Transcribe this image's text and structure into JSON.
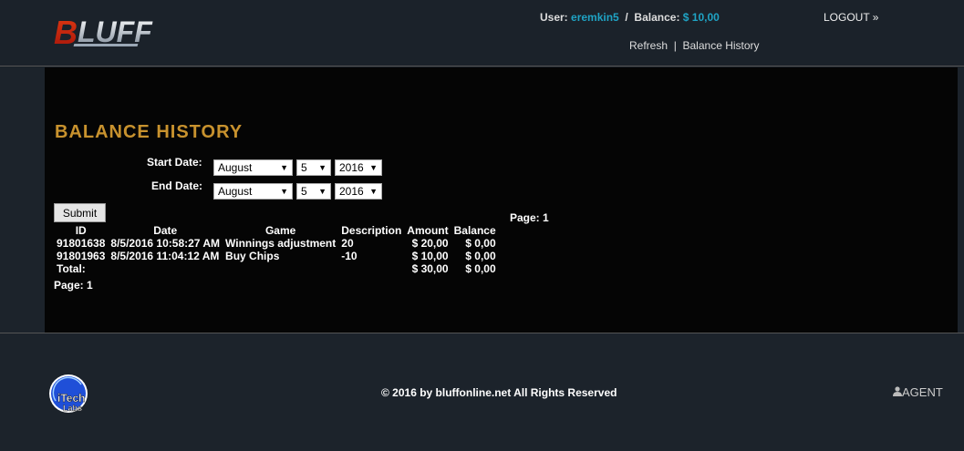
{
  "header": {
    "logo_text": "BLUFF",
    "user_label": "User:",
    "username": "eremkin5",
    "separator": "/",
    "balance_label": "Balance:",
    "balance": "$ 10,00",
    "logout": "LOGOUT »",
    "refresh": "Refresh",
    "link_sep": "|",
    "balance_history": "Balance History"
  },
  "page": {
    "title": "BALANCE HISTORY",
    "start_label": "Start Date:",
    "end_label": "End Date:",
    "start": {
      "month": "August",
      "day": "5",
      "year": "2016"
    },
    "end": {
      "month": "August",
      "day": "5",
      "year": "2016"
    },
    "submit": "Submit",
    "page_top": "Page:  1",
    "page_bottom": "Page:  1"
  },
  "table": {
    "columns": [
      "ID",
      "Date",
      "Game",
      "Description",
      "Amount",
      "Balance"
    ],
    "rows": [
      [
        "91801638",
        "8/5/2016 10:58:27 AM",
        "Winnings adjustment",
        "20",
        "$ 20,00",
        "$ 0,00"
      ],
      [
        "91801963",
        "8/5/2016 11:04:12 AM",
        "Buy Chips",
        "-10",
        "$ 10,00",
        "$ 0,00"
      ]
    ],
    "total_label": "Total:",
    "total_amount": "$ 30,00",
    "total_balance": "$ 0,00"
  },
  "footer": {
    "copyright": "© 2016 by bluffonline.net All Rights Reserved",
    "agent": "AGENT",
    "partner_logo": "iTech Labs"
  },
  "colors": {
    "accent": "#1fa3c4",
    "title": "#c8922e",
    "logo_red": "#d42a10"
  }
}
